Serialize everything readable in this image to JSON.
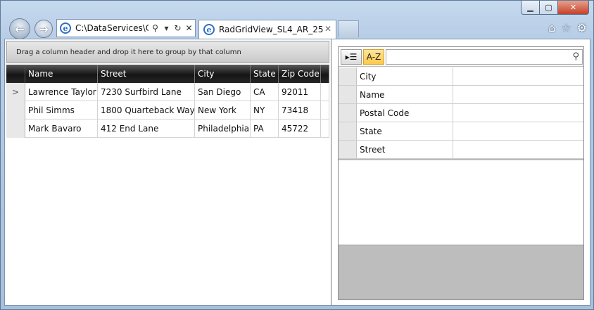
{
  "browser": {
    "address": "C:\\DataServices\\Co",
    "tab_title": "RadGridView_SL4_AR_25",
    "window_controls": {
      "minimize": "▁",
      "maximize": "▢",
      "close": "✕"
    },
    "icons": [
      "home-icon",
      "star-icon",
      "gear-icon"
    ]
  },
  "grid": {
    "group_panel_text": "Drag a column header and drop it here to group by that column",
    "columns": [
      "Name",
      "Street",
      "City",
      "State",
      "Zip Code"
    ],
    "rows": [
      {
        "name": "Lawrence Taylor",
        "street": "7230 Surfbird Lane",
        "city": "San Diego",
        "state": "CA",
        "zip": "92011"
      },
      {
        "name": "Phil Simms",
        "street": "1800 Quarteback Way",
        "city": "New York",
        "state": "NY",
        "zip": "73418"
      },
      {
        "name": "Mark Bavaro",
        "street": "412 End Lane",
        "city": "Philadelphia",
        "state": "PA",
        "zip": "45722"
      }
    ]
  },
  "property_grid": {
    "sort_label": "A-Z",
    "search_value": "",
    "properties": [
      "City",
      "Name",
      "Postal Code",
      "State",
      "Street"
    ]
  }
}
